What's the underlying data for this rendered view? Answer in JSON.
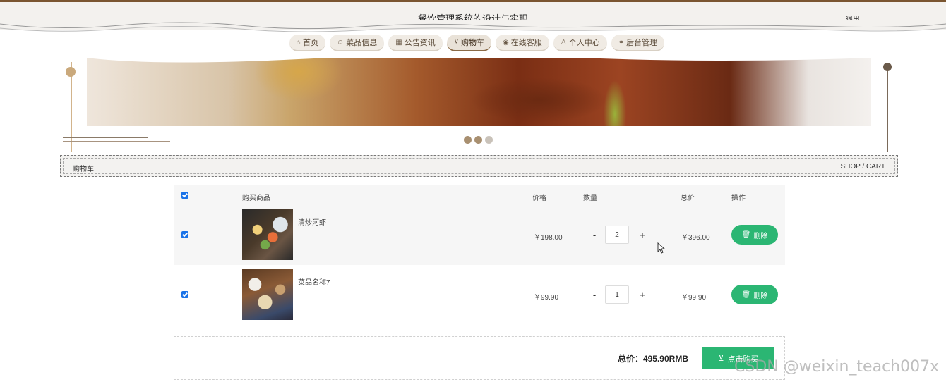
{
  "header": {
    "title": "餐饮管理系统的设计与实现",
    "logout": "退出"
  },
  "nav": [
    {
      "icon": "home-icon",
      "glyph": "⌂",
      "label": "首页",
      "active": false
    },
    {
      "icon": "dish-icon",
      "glyph": "☺",
      "label": "菜品信息",
      "active": false
    },
    {
      "icon": "notice-icon",
      "glyph": "▦",
      "label": "公告资讯",
      "active": false
    },
    {
      "icon": "cart-icon",
      "glyph": "⊻",
      "label": "购物车",
      "active": true
    },
    {
      "icon": "chat-icon",
      "glyph": "◉",
      "label": "在线客服",
      "active": false
    },
    {
      "icon": "user-icon",
      "glyph": "♙",
      "label": "个人中心",
      "active": false
    },
    {
      "icon": "link-icon",
      "glyph": "⚭",
      "label": "后台管理",
      "active": false
    }
  ],
  "carousel": {
    "slides": 3,
    "active_index": 1
  },
  "breadcrumb": {
    "title": "购物车",
    "subtitle": "SHOP / CART"
  },
  "cart": {
    "headers": {
      "product": "购买商品",
      "price": "价格",
      "quantity": "数量",
      "total": "总价",
      "action": "操作"
    },
    "items": [
      {
        "name": "清炒河虾",
        "price": "￥198.00",
        "quantity": "2",
        "total": "￥396.00",
        "delete": "删除",
        "checked": true
      },
      {
        "name": "菜品名称7",
        "price": "￥99.90",
        "quantity": "1",
        "total": "￥99.90",
        "delete": "删除",
        "checked": true
      }
    ],
    "minus": "-",
    "plus": "+"
  },
  "summary": {
    "total_label": "总价：495.90RMB",
    "buy_label": "点击购买"
  },
  "watermark": "CSDN @weixin_teach007x",
  "colors": {
    "accent_green": "#2bb673",
    "brown": "#7a5530",
    "checkbox_blue": "#1a73e8"
  }
}
